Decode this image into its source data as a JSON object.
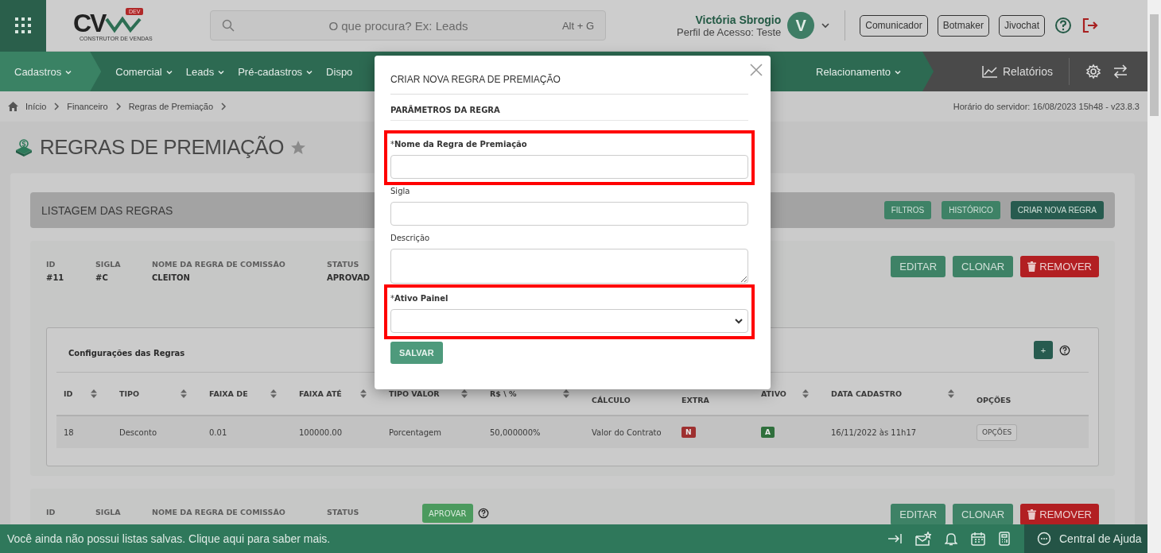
{
  "header": {
    "logo": {
      "letters": "CV",
      "badge": "DEV",
      "tagline": "CONSTRUTOR DE VENDAS"
    },
    "search": {
      "placeholder": "O que procura? Ex: Leads",
      "shortcut": "Alt + G"
    },
    "user": {
      "name": "Victória Sbrogio",
      "profile": "Perfil de Acesso: Teste",
      "avatar": "V"
    },
    "buttons": [
      "Comunicador",
      "Botmaker",
      "Jivochat"
    ]
  },
  "nav": {
    "items": [
      {
        "label": "Cadastros",
        "selected": true
      },
      {
        "label": "Comercial",
        "selected": false
      },
      {
        "label": "Leads",
        "selected": false
      },
      {
        "label": "Pré-cadastros",
        "selected": false
      },
      {
        "label": "Dispo",
        "selected": false
      }
    ],
    "trailing": {
      "label": "Relacionamento",
      "selected": false
    },
    "reports": "Relatórios"
  },
  "breadcrumb": {
    "items": [
      "Início",
      "Financeiro",
      "Regras de Premiação"
    ],
    "server_time": "Horário do servidor: 16/08/2023 15h48 - v23.8.3"
  },
  "page_title": "REGRAS DE PREMIAÇÃO",
  "listing": {
    "title": "LISTAGEM DAS REGRAS",
    "buttons": [
      {
        "label": "FILTROS",
        "kind": "green"
      },
      {
        "label": "HISTÓRICO",
        "kind": "green"
      },
      {
        "label": "CRIAR NOVA REGRA",
        "kind": "dark"
      }
    ]
  },
  "rules": [
    {
      "fields": [
        {
          "label": "ID",
          "value": "#11"
        },
        {
          "label": "SIGLA",
          "value": "#C"
        },
        {
          "label": "NOME DA REGRA DE COMISSÃO",
          "value": "CLEITON"
        },
        {
          "label": "STATUS",
          "value": "APROVAD"
        }
      ],
      "actions": [
        {
          "label": "EDITAR",
          "kind": "green"
        },
        {
          "label": "CLONAR",
          "kind": "green"
        },
        {
          "label": "REMOVER",
          "kind": "danger"
        }
      ],
      "config": {
        "title": "Configurações das Regras",
        "add": "+",
        "columns": [
          {
            "label": "ID",
            "sortable": true
          },
          {
            "label": "TIPO",
            "sortable": true
          },
          {
            "label": "FAIXA DE",
            "sortable": true
          },
          {
            "label": "FAIXA ATÉ",
            "sortable": true
          },
          {
            "label": "TIPO VALOR",
            "sortable": true
          },
          {
            "label": "R$ \\ %",
            "sortable": true
          },
          {
            "label": "CÁLCULO",
            "sortable": false
          },
          {
            "label": "EXTRA",
            "sortable": false
          },
          {
            "label": "ATIVO",
            "sortable": true
          },
          {
            "label": "DATA CADASTRO",
            "sortable": true
          },
          {
            "label": "OPÇÕES",
            "sortable": false
          }
        ],
        "rows": [
          [
            {
              "kind": "text",
              "text": "18"
            },
            {
              "kind": "text",
              "text": "Desconto"
            },
            {
              "kind": "text",
              "text": "0.01"
            },
            {
              "kind": "text",
              "text": "100000.00"
            },
            {
              "kind": "text",
              "text": "Porcentagem"
            },
            {
              "kind": "text",
              "text": "50,000000%"
            },
            {
              "kind": "text",
              "text": "Valor do Contrato"
            },
            {
              "kind": "badge",
              "text": "N",
              "color": "#9e3030"
            },
            {
              "kind": "badge",
              "text": "A",
              "color": "#2f6f3c"
            },
            {
              "kind": "text",
              "text": "16/11/2022 às 11h17"
            },
            {
              "kind": "button",
              "text": "OPÇÕES"
            }
          ]
        ]
      }
    },
    {
      "fields": [
        {
          "label": "ID"
        },
        {
          "label": "SIGLA"
        },
        {
          "label": "NOME DA REGRA DE COMISSÃO"
        },
        {
          "label": "STATUS"
        }
      ],
      "approve": "APROVAR",
      "actions": [
        {
          "label": "EDITAR",
          "kind": "green"
        },
        {
          "label": "CLONAR",
          "kind": "green"
        },
        {
          "label": "REMOVER",
          "kind": "danger"
        }
      ]
    }
  ],
  "bottom_bar": {
    "message": "Você ainda não possui listas salvas. Clique aqui para saber mais.",
    "help": "Central de Ajuda"
  },
  "modal": {
    "title": "CRIAR NOVA REGRA DE PREMIAÇÃO",
    "section": "PARÂMETROS DA REGRA",
    "fields": [
      {
        "label": "Nome da Regra de Premiação",
        "mark": "*",
        "kind": "text",
        "highlighted": true
      },
      {
        "label": "Sigla",
        "kind": "text",
        "highlighted": false
      },
      {
        "label": "Descrição",
        "kind": "textarea",
        "highlighted": false
      },
      {
        "label": "Ativo Painel",
        "mark": "*",
        "kind": "select",
        "highlighted": true
      }
    ],
    "submit": "SALVAR"
  }
}
